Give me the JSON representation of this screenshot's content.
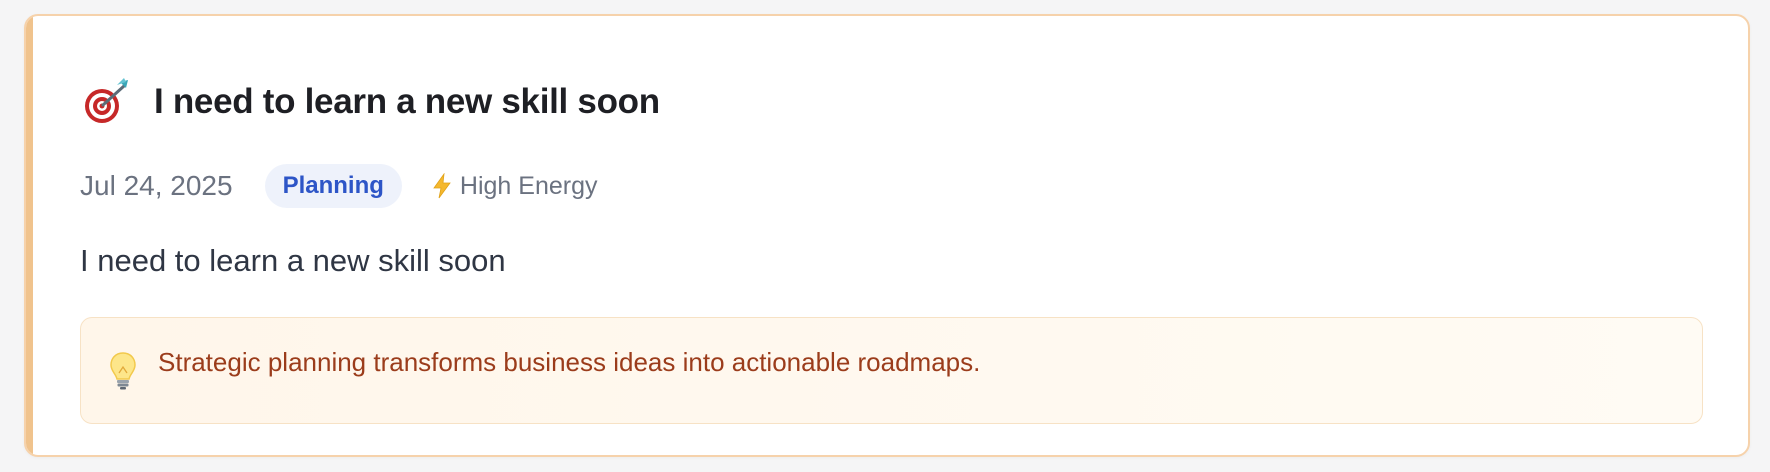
{
  "entry": {
    "icon": "target-dart-icon",
    "title": "I need to learn a new skill soon",
    "date": "Jul 24, 2025",
    "category": "Planning",
    "energy": {
      "icon": "lightning-bolt-icon",
      "label": "High Energy"
    },
    "content": "I need to learn a new skill soon",
    "insight": {
      "icon": "lightbulb-icon",
      "text": "Strategic planning transforms business ideas into actionable roadmaps."
    }
  },
  "colors": {
    "card_border": "#f6d2ab",
    "accent_bar": "#f0c38d",
    "tag_background": "#eef2fb",
    "tag_text": "#2d55c7",
    "insight_background": "#fff6ea",
    "insight_text": "#9b3c1b"
  }
}
